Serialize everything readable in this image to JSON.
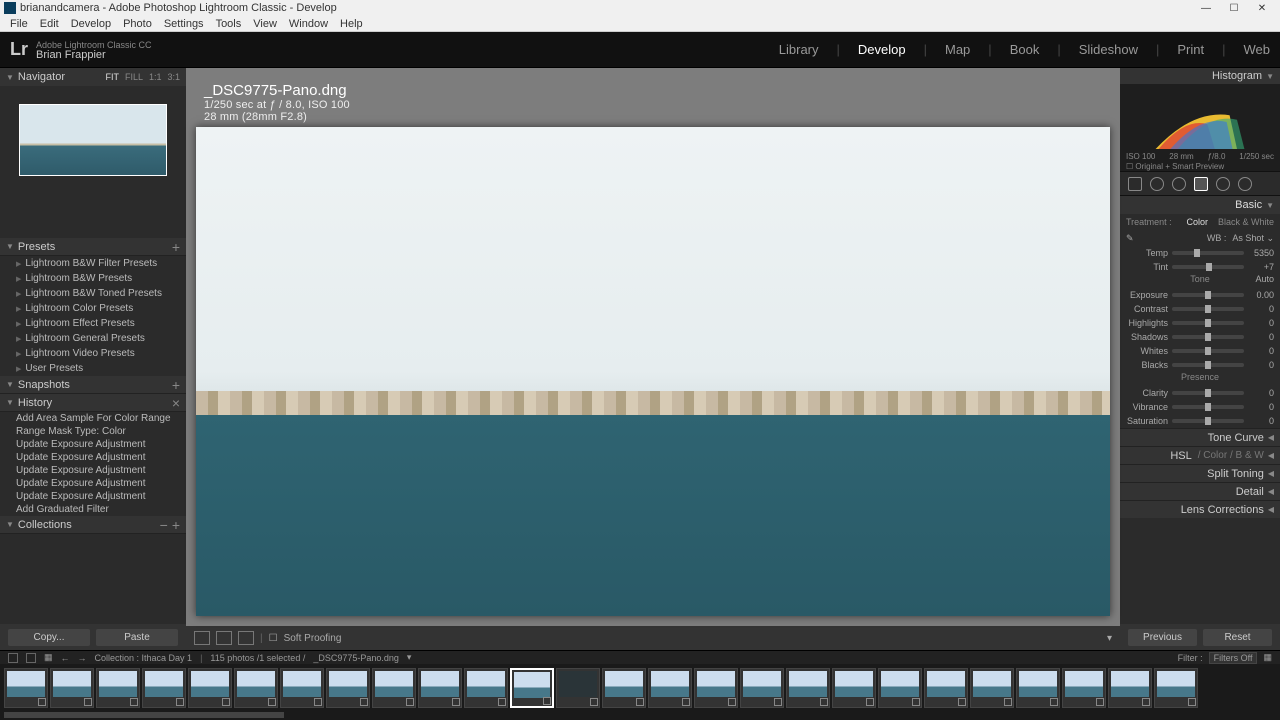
{
  "window": {
    "title": "brianandcamera - Adobe Photoshop Lightroom Classic - Develop"
  },
  "menu": [
    "File",
    "Edit",
    "Develop",
    "Photo",
    "Settings",
    "Tools",
    "View",
    "Window",
    "Help"
  ],
  "identity": {
    "logo": "Lr",
    "line1": "Adobe Lightroom Classic CC",
    "line2": "Brian Frappier"
  },
  "modules": [
    "Library",
    "Develop",
    "Map",
    "Book",
    "Slideshow",
    "Print",
    "Web"
  ],
  "active_module": "Develop",
  "navigator": {
    "title": "Navigator",
    "zoom": [
      "FIT",
      "FILL",
      "1:1",
      "3:1"
    ],
    "zoom_active": "FIT"
  },
  "left_panels": {
    "presets": {
      "title": "Presets",
      "items": [
        "Lightroom B&W Filter Presets",
        "Lightroom B&W Presets",
        "Lightroom B&W Toned Presets",
        "Lightroom Color Presets",
        "Lightroom Effect Presets",
        "Lightroom General Presets",
        "Lightroom Video Presets",
        "User Presets"
      ]
    },
    "snapshots": {
      "title": "Snapshots"
    },
    "history": {
      "title": "History",
      "items": [
        "Add Area Sample For Color Range",
        "Range Mask Type: Color",
        "Update Exposure Adjustment",
        "Update Exposure Adjustment",
        "Update Exposure Adjustment",
        "Update Exposure Adjustment",
        "Update Exposure Adjustment",
        "Add Graduated Filter"
      ]
    },
    "collections": {
      "title": "Collections"
    },
    "copy_btn": "Copy...",
    "paste_btn": "Paste"
  },
  "image": {
    "filename": "_DSC9775-Pano.dng",
    "exposure": "1/250 sec at ƒ / 8.0, ISO 100",
    "lens": "28 mm (28mm F2.8)"
  },
  "center_toolbar": {
    "soft_proofing": "Soft Proofing"
  },
  "right": {
    "histogram": {
      "title": "Histogram",
      "iso": "ISO 100",
      "focal": "28 mm",
      "ap": "ƒ/8.0",
      "ss": "1/250 sec",
      "preview": "Original + Smart Preview"
    },
    "basic": {
      "title": "Basic",
      "treatment_label": "Treatment :",
      "treat_color": "Color",
      "treat_bw": "Black & White",
      "wb_label": "WB :",
      "wb_value": "As Shot",
      "temp": {
        "name": "Temp",
        "value": "5350"
      },
      "tint": {
        "name": "Tint",
        "value": "+7"
      },
      "tone_label": "Tone",
      "auto": "Auto",
      "sliders_tone": [
        {
          "name": "Exposure",
          "value": "0.00"
        },
        {
          "name": "Contrast",
          "value": "0"
        },
        {
          "name": "Highlights",
          "value": "0"
        },
        {
          "name": "Shadows",
          "value": "0"
        },
        {
          "name": "Whites",
          "value": "0"
        },
        {
          "name": "Blacks",
          "value": "0"
        }
      ],
      "presence_label": "Presence",
      "sliders_presence": [
        {
          "name": "Clarity",
          "value": "0"
        },
        {
          "name": "Vibrance",
          "value": "0"
        },
        {
          "name": "Saturation",
          "value": "0"
        }
      ]
    },
    "closed_panels": [
      {
        "title": "Tone Curve"
      },
      {
        "title": "HSL",
        "sub": "/  Color  /  B & W"
      },
      {
        "title": "Split Toning"
      },
      {
        "title": "Detail"
      },
      {
        "title": "Lens Corrections"
      }
    ],
    "prev_btn": "Previous",
    "reset_btn": "Reset"
  },
  "filmbar": {
    "collection": "Collection : Ithaca Day 1",
    "count": "115 photos /1 selected /",
    "filename": "_DSC9775-Pano.dng",
    "filter_label": "Filter :",
    "filter_value": "Filters Off"
  },
  "film_thumbs": 26,
  "film_selected_index": 11
}
